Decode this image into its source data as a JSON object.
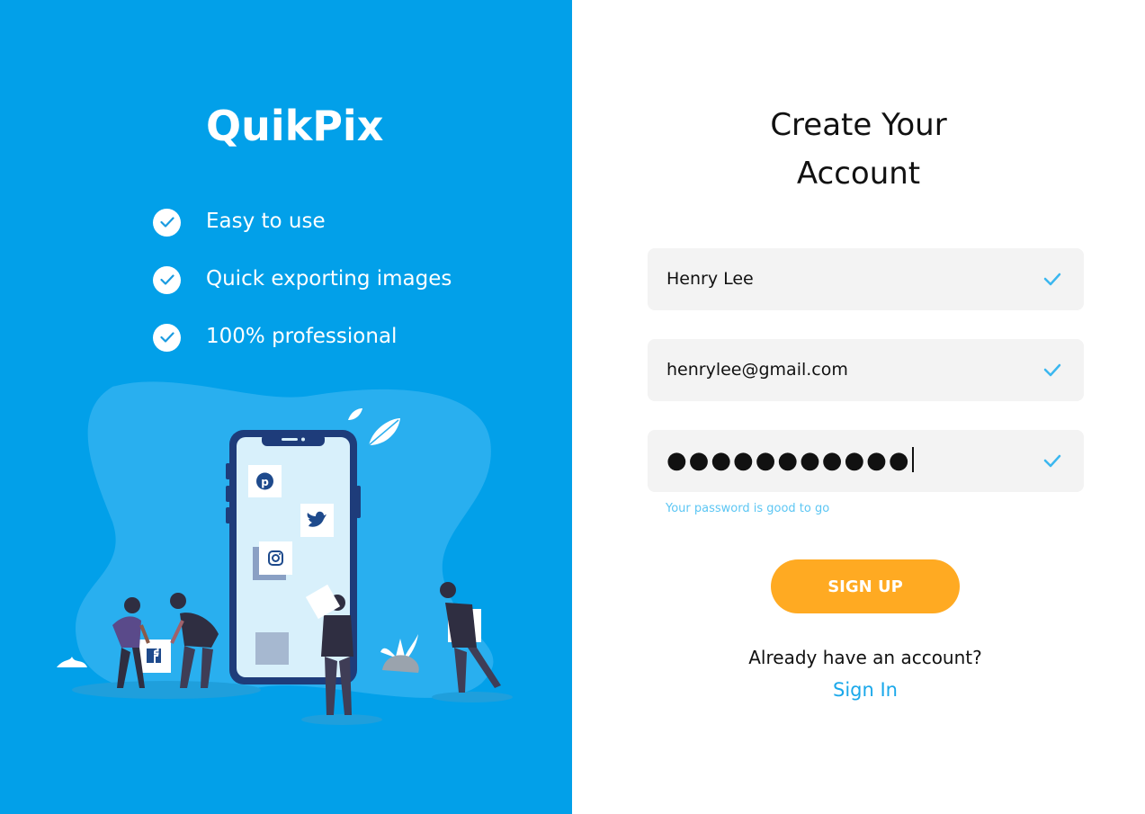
{
  "brand": {
    "logo": "QuikPix"
  },
  "features": [
    {
      "label": "Easy to use"
    },
    {
      "label": "Quick exporting images"
    },
    {
      "label": "100% professional"
    }
  ],
  "form": {
    "title_line1": "Create Your",
    "title_line2": "Account",
    "name_value": "Henry Lee",
    "email_value": "henrylee@gmail.com",
    "password_masked": "●●●●●●●●●●●",
    "password_hint": "Your password is good to go",
    "signup_label": "SIGN UP",
    "already_text": "Already have an account?",
    "signin_label": "Sign In"
  },
  "colors": {
    "left_panel_bg": "#02a0e9",
    "field_bg": "#f3f3f3",
    "check_color": "#3bb7ef",
    "signup_bg": "#ffaa22",
    "link_color": "#1aa8ea"
  },
  "icons": {
    "feature_check": "check-circle-icon",
    "field_valid": "check-icon",
    "social": [
      "pinterest-icon",
      "twitter-icon",
      "instagram-icon",
      "facebook-icon",
      "youtube-icon"
    ]
  }
}
